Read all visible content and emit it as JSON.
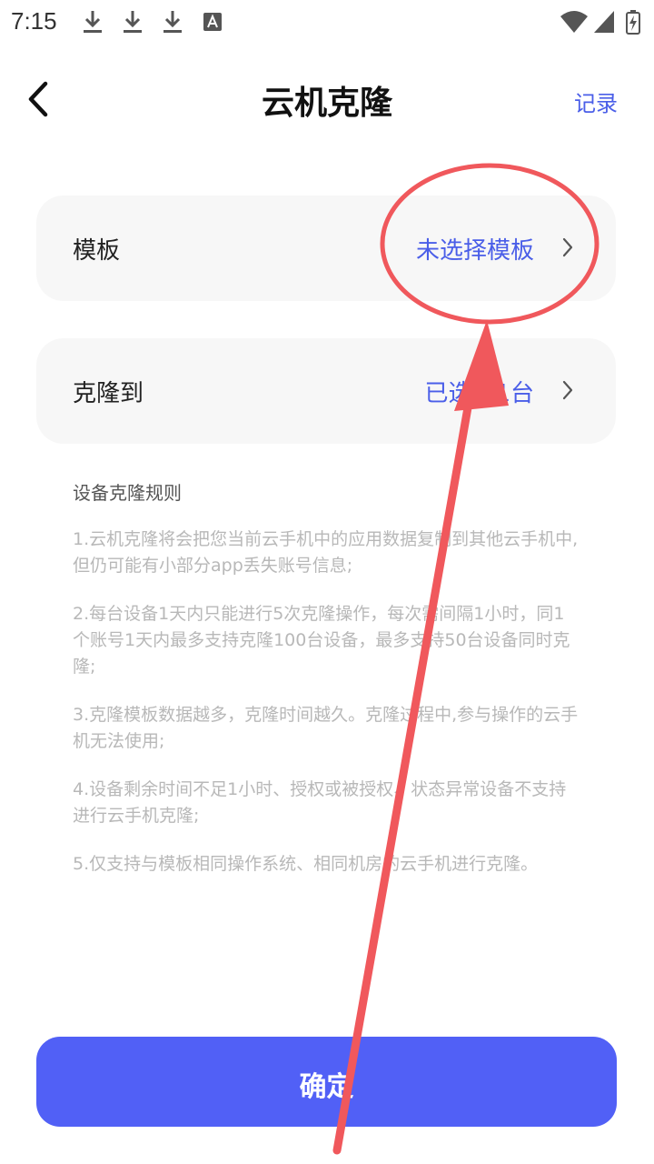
{
  "status_bar": {
    "time": "7:15",
    "icons": [
      "download-icon",
      "download-icon",
      "download-icon",
      "a-box-icon",
      "wifi-icon",
      "signal-icon",
      "battery-charging-icon"
    ]
  },
  "header": {
    "title": "云机克隆",
    "right_link": "记录",
    "back_icon": "chevron-left-icon"
  },
  "cards": [
    {
      "label": "模板",
      "value": "未选择模板",
      "icon": "chevron-right-icon"
    },
    {
      "label": "克隆到",
      "value": "已选择1台",
      "icon": "chevron-right-icon"
    }
  ],
  "rules": {
    "title": "设备克隆规则",
    "items": [
      "1.云机克隆将会把您当前云手机中的应用数据复制到其他云手机中,但仍可能有小部分app丢失账号信息;",
      "2.每台设备1天内只能进行5次克隆操作，每次需间隔1小时，同1个账号1天内最多支持克隆100台设备，最多支持50台设备同时克隆;",
      "3.克隆模板数据越多，克隆时间越久。克隆过程中,参与操作的云手机无法使用;",
      "4.设备剩余时间不足1小时、授权或被授权、状态异常设备不支持进行云手机克隆;",
      "5.仅支持与模板相同操作系统、相同机房的云手机进行克隆。"
    ]
  },
  "confirm_button": {
    "label": "确定"
  },
  "colors": {
    "accent": "#4a5ee8",
    "button": "#5160f6",
    "card_bg": "#f7f7f7",
    "annotation": "#f0585c"
  }
}
